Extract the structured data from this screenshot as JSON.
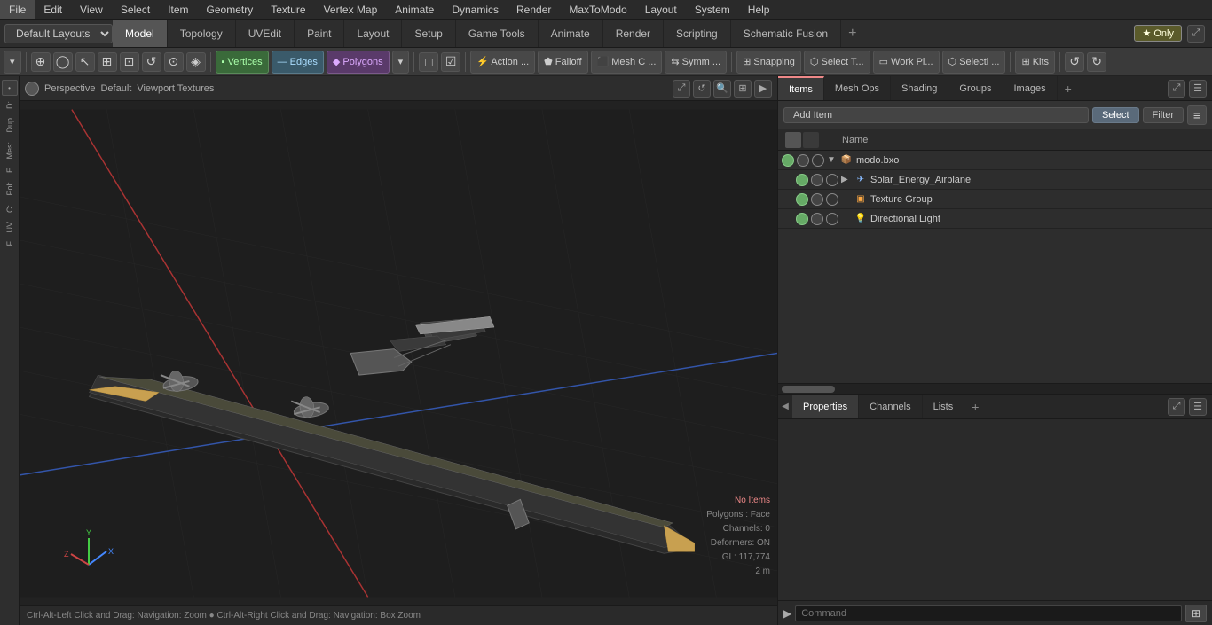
{
  "menu": {
    "items": [
      "File",
      "Edit",
      "View",
      "Select",
      "Item",
      "Geometry",
      "Texture",
      "Vertex Map",
      "Animate",
      "Dynamics",
      "Render",
      "MaxToModo",
      "Layout",
      "System",
      "Help"
    ]
  },
  "layout_bar": {
    "dropdown": "Default Layouts",
    "tabs": [
      "Model",
      "Topology",
      "UVEdit",
      "Paint",
      "Layout",
      "Setup",
      "Game Tools",
      "Animate",
      "Render",
      "Scripting",
      "Schematic Fusion"
    ],
    "active_tab": "Model",
    "add_icon": "+",
    "star_only": "★ Only"
  },
  "toolbar": {
    "buttons": [
      {
        "label": "▾",
        "id": "mode-dropdown"
      },
      {
        "label": "⊕",
        "id": "globe-btn"
      },
      {
        "label": "◯",
        "id": "circle-btn"
      },
      {
        "label": "↖",
        "id": "select-btn"
      },
      {
        "label": "⊞",
        "id": "grid-btn"
      },
      {
        "label": "⊡",
        "id": "grid2-btn"
      },
      {
        "label": "↺",
        "id": "rotate-btn"
      },
      {
        "label": "⊙",
        "id": "target-btn"
      },
      {
        "label": "◈",
        "id": "diamond-btn"
      },
      {
        "label": "Vertices",
        "id": "vertices-btn"
      },
      {
        "label": "Edges",
        "id": "edges-btn"
      },
      {
        "label": "Polygons",
        "id": "polygons-btn"
      },
      {
        "label": "▾",
        "id": "poly-dropdown"
      },
      {
        "label": "□",
        "id": "display-btn"
      },
      {
        "label": "☑",
        "id": "check-btn"
      },
      {
        "label": "Action ...",
        "id": "action-btn"
      },
      {
        "label": "Falloff",
        "id": "falloff-btn"
      },
      {
        "label": "Mesh C ...",
        "id": "mesh-btn"
      },
      {
        "label": "Symm ...",
        "id": "symm-btn"
      },
      {
        "label": "⊞ Snapping",
        "id": "snapping-btn"
      },
      {
        "label": "Select T...",
        "id": "select-tool-btn"
      },
      {
        "label": "Work Pl...",
        "id": "work-plane-btn"
      },
      {
        "label": "Selecti ...",
        "id": "selection-btn"
      },
      {
        "label": "Kits",
        "id": "kits-btn"
      },
      {
        "label": "↺",
        "id": "undo-icon"
      },
      {
        "label": "↻",
        "id": "redo-icon"
      }
    ]
  },
  "left_panel": {
    "labels": [
      "D:",
      "Dup",
      "Mes:",
      "E",
      "Pol:",
      "C:",
      "UV",
      "F"
    ]
  },
  "viewport": {
    "dot": "●",
    "camera": "Perspective",
    "shading": "Default",
    "textures": "Viewport Textures",
    "nav_buttons": [
      "⤢",
      "↺",
      "🔍",
      "⊞",
      "▶"
    ],
    "status": {
      "no_items": "No Items",
      "polygons": "Polygons : Face",
      "channels": "Channels: 0",
      "deformers": "Deformers: ON",
      "gl": "GL: 117,774",
      "scale": "2 m"
    }
  },
  "right_panel": {
    "items_tabs": [
      "Items",
      "Mesh Ops",
      "Shading",
      "Groups",
      "Images"
    ],
    "active_items_tab": "Items",
    "toolbar": {
      "add_item": "Add Item",
      "select": "Select",
      "filter": "Filter"
    },
    "tree": {
      "root": {
        "name": "modo.bxo",
        "icon": "📦",
        "children": [
          {
            "name": "Solar_Energy_Airplane",
            "icon": "✈",
            "children": []
          },
          {
            "name": "Texture Group",
            "icon": "🔲",
            "children": []
          },
          {
            "name": "Directional Light",
            "icon": "💡",
            "children": []
          }
        ]
      }
    },
    "properties_tabs": [
      "Properties",
      "Channels",
      "Lists"
    ],
    "active_props_tab": "Properties",
    "command_placeholder": "Command"
  },
  "bottom_bar": {
    "text": "Ctrl-Alt-Left Click and Drag: Navigation: Zoom  ●  Ctrl-Alt-Right Click and Drag: Navigation: Box Zoom"
  }
}
